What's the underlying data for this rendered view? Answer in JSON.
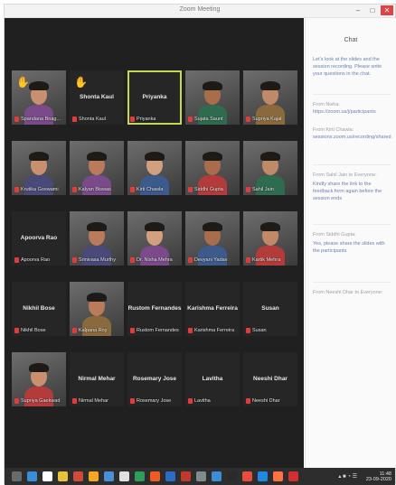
{
  "window": {
    "title": "Zoom Meeting"
  },
  "window_controls": {
    "minimize": "–",
    "maximize": "□",
    "close": "✕"
  },
  "participants": [
    {
      "name": "Spandana Bnag...",
      "hand_raised": true,
      "video": true
    },
    {
      "name": "Shonta Kaul",
      "hand_raised": true,
      "video": false
    },
    {
      "name": "Priyanka",
      "video": false,
      "active_speaker": true
    },
    {
      "name": "Sujata Saunt",
      "video": true
    },
    {
      "name": "Supriya Kajal",
      "video": true
    },
    {
      "name": "Krutika Goswami",
      "video": true
    },
    {
      "name": "Kalyan Biswas",
      "video": true
    },
    {
      "name": "Kirti Chawla",
      "video": true
    },
    {
      "name": "Siddhi Gupta",
      "video": true
    },
    {
      "name": "Sahil Jain",
      "video": true
    },
    {
      "name": "Apoorva Rao",
      "video": false
    },
    {
      "name": "Srinivasa Murthy",
      "video": true
    },
    {
      "name": "Dr. Nisha Mehra",
      "video": true
    },
    {
      "name": "Devyani Yadav",
      "video": true
    },
    {
      "name": "Kartik Mehra",
      "video": true
    },
    {
      "name": "Nikhil Bose",
      "video": false
    },
    {
      "name": "Kalpana Roy",
      "video": true
    },
    {
      "name": "Rustom Fernandes",
      "video": false
    },
    {
      "name": "Karishma Ferreira",
      "video": false
    },
    {
      "name": "Susan",
      "video": false
    },
    {
      "name": "Supriya Gaekwad",
      "video": true
    },
    {
      "name": "Nirmal Mehar",
      "video": false
    },
    {
      "name": "Rosemary Jose",
      "video": false
    },
    {
      "name": "Lavitha",
      "video": false
    },
    {
      "name": "Neeshi Dhar",
      "video": false
    }
  ],
  "chat": {
    "title": "Chat",
    "messages": [
      {
        "sender": "",
        "text": "Let's look at the slides and the session recording. Please write your questions in the chat."
      },
      {
        "sender": "From Nisha:",
        "text": "https://zoom.us/j/participants"
      },
      {
        "sender": "From Kirti Chawla:",
        "text": "sessions.zoom.us/recording/shared"
      },
      {
        "sender": "From Sahil Jain to Everyone:",
        "text": ""
      },
      {
        "sender": "",
        "text": "Kindly share the link to the feedback form again before the session ends"
      },
      {
        "sender": "From Siddhi Gupta:",
        "text": ""
      },
      {
        "sender": "",
        "text": "Yes, please share the slides with the participants"
      },
      {
        "sender": "From Neeshi Dhar to Everyone:",
        "text": ""
      }
    ]
  },
  "taskbar": {
    "time": "11:48",
    "date": "23-09-2020",
    "tray": "▴ ■ ◔ ☰"
  }
}
